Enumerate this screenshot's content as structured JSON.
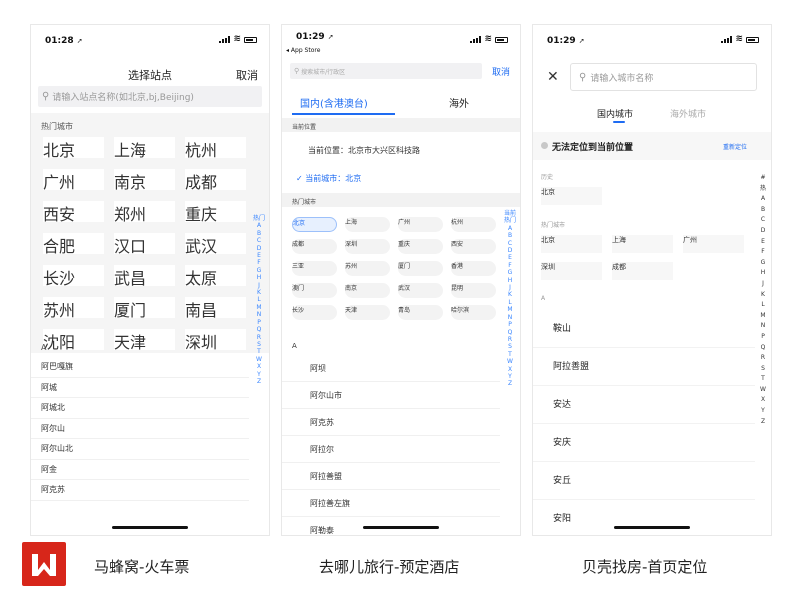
{
  "colors": {
    "brand": "#1f6cf2",
    "logo_bg": "#d7261a",
    "accent_text": "#3a86ff"
  },
  "p1": {
    "time": "01:28",
    "title": "选择站点",
    "cancel": "取消",
    "search_placeholder": "请输入站点名称(如北京,bj,Beijing)",
    "hot_label": "热门城市",
    "hot": [
      "北京",
      "上海",
      "杭州",
      "广州",
      "南京",
      "成都",
      "西安",
      "郑州",
      "重庆",
      "合肥",
      "汉口",
      "武汉",
      "长沙",
      "武昌",
      "太原",
      "苏州",
      "厦门",
      "南昌",
      "沈阳",
      "天津",
      "深圳"
    ],
    "index": [
      "热门",
      "A",
      "B",
      "C",
      "D",
      "E",
      "F",
      "G",
      "H",
      "J",
      "K",
      "L",
      "M",
      "N",
      "P",
      "Q",
      "R",
      "S",
      "T",
      "W",
      "X",
      "Y",
      "Z"
    ],
    "section": "A",
    "list": [
      "阿巴嘎旗",
      "阿城",
      "阿城北",
      "阿尔山",
      "阿尔山北",
      "阿金",
      "阿克苏"
    ]
  },
  "p2": {
    "time": "01:29",
    "back": "◂ App Store",
    "search_placeholder": "搜索城市/行政区",
    "cancel": "取消",
    "tab_domestic": "国内(含港澳台)",
    "tab_overseas": "海外",
    "current_label": "当前位置",
    "current_loc": "当前位置：北京市大兴区科技路",
    "current_city": "✓ 当前城市：北京",
    "hot_label": "热门城市",
    "hot": [
      "北京",
      "上海",
      "广州",
      "杭州",
      "成都",
      "深圳",
      "重庆",
      "西安",
      "三亚",
      "苏州",
      "厦门",
      "香港",
      "澳门",
      "南京",
      "武汉",
      "昆明",
      "长沙",
      "天津",
      "青岛",
      "哈尔滨"
    ],
    "index": [
      "当前",
      "热门",
      "A",
      "B",
      "C",
      "D",
      "E",
      "F",
      "G",
      "H",
      "J",
      "K",
      "L",
      "M",
      "N",
      "P",
      "Q",
      "R",
      "S",
      "T",
      "W",
      "X",
      "Y",
      "Z"
    ],
    "section": "A",
    "list": [
      "阿坝",
      "阿尔山市",
      "阿克苏",
      "阿拉尔",
      "阿拉善盟",
      "阿拉善左旗",
      "阿勒泰"
    ]
  },
  "p3": {
    "time": "01:29",
    "search_placeholder": "请输入城市名称",
    "tab_domestic": "国内城市",
    "tab_overseas": "海外城市",
    "locate_fail": "无法定位到当前位置",
    "relocate": "重新定位",
    "history_label": "历史",
    "history": [
      "北京"
    ],
    "hot_label": "热门城市",
    "hot": [
      "北京",
      "上海",
      "广州",
      "深圳",
      "成都"
    ],
    "section": "A",
    "list": [
      "鞍山",
      "阿拉善盟",
      "安达",
      "安庆",
      "安丘",
      "安阳"
    ],
    "index": [
      "#",
      "热",
      "A",
      "B",
      "C",
      "D",
      "E",
      "F",
      "G",
      "H",
      "J",
      "K",
      "L",
      "M",
      "N",
      "P",
      "Q",
      "R",
      "S",
      "T",
      "W",
      "X",
      "Y",
      "Z"
    ]
  },
  "captions": [
    "马蜂窝-火车票",
    "去哪儿旅行-预定酒店",
    "贝壳找房-首页定位"
  ]
}
